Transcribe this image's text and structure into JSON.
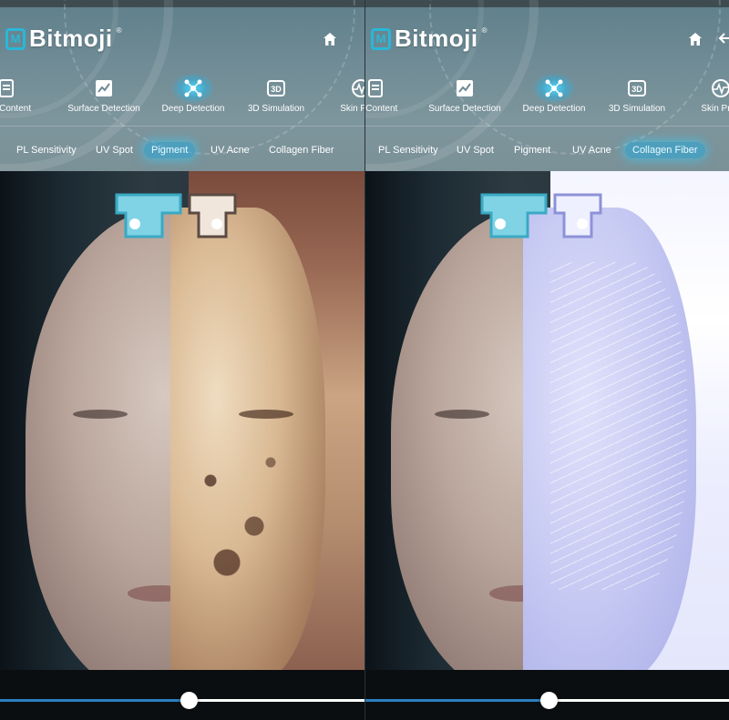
{
  "panels": [
    {
      "logo_text": "Bitmoji",
      "logo_reg": "®",
      "nav": [
        {
          "label": "ure Content",
          "icon": "document-icon"
        },
        {
          "label": "Surface Detection",
          "icon": "chart-icon"
        },
        {
          "label": "Deep Detection",
          "icon": "molecule-icon",
          "active": true
        },
        {
          "label": "3D Simulation",
          "icon": "3d-icon"
        },
        {
          "label": "Skin Predi",
          "icon": "pulse-icon"
        }
      ],
      "tabs": [
        {
          "label": "PL Sensitivity"
        },
        {
          "label": "UV Spot"
        },
        {
          "label": "Pigment",
          "active": true
        },
        {
          "label": "UV Acne"
        },
        {
          "label": "Collagen Fiber"
        }
      ],
      "slider_progress": 0.52
    },
    {
      "logo_text": "Bitmoji",
      "logo_reg": "®",
      "nav": [
        {
          "label": "re Content",
          "icon": "document-icon"
        },
        {
          "label": "Surface Detection",
          "icon": "chart-icon"
        },
        {
          "label": "Deep Detection",
          "icon": "molecule-icon",
          "active": true
        },
        {
          "label": "3D Simulation",
          "icon": "3d-icon"
        },
        {
          "label": "Skin Pred",
          "icon": "pulse-icon"
        }
      ],
      "tabs": [
        {
          "label": "PL Sensitivity"
        },
        {
          "label": "UV Spot"
        },
        {
          "label": "Pigment"
        },
        {
          "label": "UV Acne"
        },
        {
          "label": "Collagen Fiber",
          "active": true
        }
      ],
      "slider_progress": 0.5
    }
  ],
  "colors": {
    "accent": "#2ab7d8",
    "active_glow": "#50dcff",
    "slider_fill": "#2b7fc0"
  }
}
